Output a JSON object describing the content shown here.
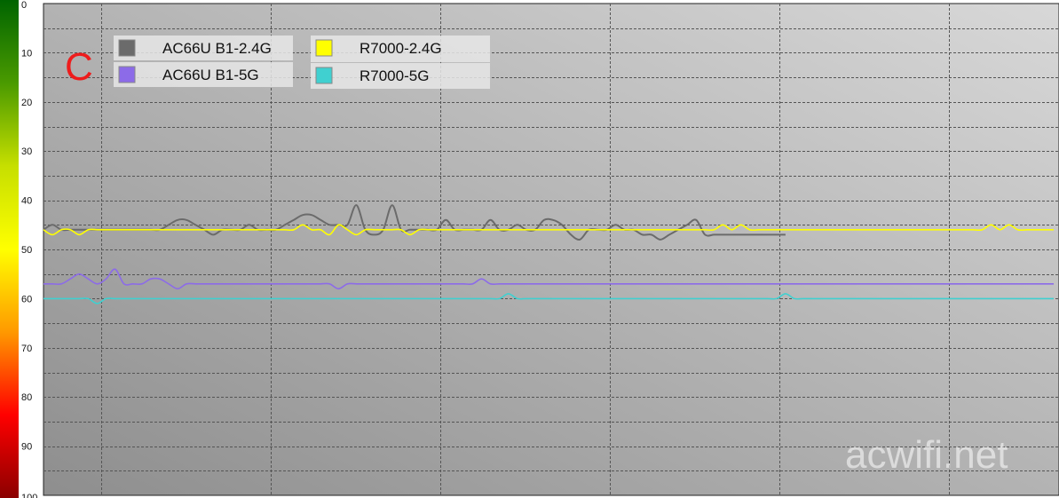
{
  "chart_data": {
    "type": "line",
    "ylim": [
      0,
      100
    ],
    "y_inverted": true,
    "y_ticks": [
      "0",
      "10",
      "20",
      "30",
      "40",
      "50",
      "60",
      "70",
      "80",
      "90",
      "100"
    ],
    "grid": true,
    "legend_position": "top-left",
    "annotation": "C",
    "watermark": "acwifi.net",
    "background_gradient": [
      "#d8d8d8",
      "#8e8e8e"
    ],
    "scale_colors": [
      "#006400",
      "#4a9a00",
      "#c6df00",
      "#ffff00",
      "#ff9900",
      "#ff0000",
      "#8b0000"
    ],
    "x": [
      0,
      10,
      20,
      30,
      40,
      50,
      60,
      70,
      80,
      90,
      100,
      110,
      120,
      130,
      140,
      150,
      160,
      170,
      180,
      190,
      200,
      210,
      220,
      230,
      240,
      250,
      260,
      270,
      280,
      290,
      300,
      310,
      320,
      330,
      340,
      350,
      360,
      370,
      380,
      390,
      400,
      410,
      420,
      430,
      440,
      450,
      460,
      470,
      480,
      490,
      500,
      510,
      520,
      530,
      540,
      550,
      560,
      570,
      580,
      590,
      600,
      610,
      620,
      630,
      640,
      650,
      660,
      670,
      680,
      690,
      700,
      710,
      720,
      730,
      740,
      750,
      760,
      770,
      780,
      790,
      800,
      810,
      820,
      830,
      840,
      850,
      860,
      870,
      880,
      890,
      900,
      910,
      920,
      930,
      940,
      950,
      960,
      970,
      980,
      990,
      1000,
      1010,
      1020,
      1030,
      1040,
      1050,
      1060,
      1070,
      1080,
      1090,
      1100,
      1110,
      1120,
      1130
    ],
    "series": [
      {
        "name": "AC66U B1-2.4G",
        "color": "#6b6b6b",
        "values": [
          46,
          45,
          46,
          46,
          46,
          46,
          46,
          46,
          46,
          46,
          46,
          46,
          46,
          46,
          45,
          44,
          44,
          45,
          46,
          47,
          46,
          46,
          46,
          45,
          46,
          46,
          46,
          45,
          44,
          43,
          43,
          44,
          45,
          45,
          45,
          41,
          46,
          47,
          46,
          41,
          46,
          46,
          46,
          46,
          46,
          44,
          46,
          46,
          46,
          46,
          44,
          46,
          46,
          45,
          46,
          46,
          44,
          44,
          45,
          47,
          48,
          46,
          46,
          46,
          45,
          46,
          46,
          47,
          47,
          48,
          47,
          46,
          45,
          44,
          47,
          47,
          47,
          47,
          47,
          47,
          47,
          47,
          47,
          47
        ]
      },
      {
        "name": "AC66U B1-5G",
        "color": "#8c6be8",
        "values": [
          57,
          57,
          57,
          56,
          55,
          56,
          57,
          56,
          54,
          57,
          57,
          57,
          56,
          56,
          57,
          58,
          57,
          57,
          57,
          57,
          57,
          57,
          57,
          57,
          57,
          57,
          57,
          57,
          57,
          57,
          57,
          57,
          57,
          58,
          57,
          57,
          57,
          57,
          57,
          57,
          57,
          57,
          57,
          57,
          57,
          57,
          57,
          57,
          57,
          56,
          57,
          57,
          57,
          57,
          57,
          57,
          57,
          57,
          57,
          57,
          57,
          57,
          57,
          57,
          57,
          57,
          57,
          57,
          57,
          57,
          57,
          57,
          57,
          57,
          57,
          57,
          57,
          57,
          57,
          57,
          57,
          57,
          57,
          57,
          57,
          57,
          57,
          57,
          57,
          57,
          57,
          57,
          57,
          57,
          57,
          57,
          57,
          57,
          57,
          57,
          57,
          57,
          57,
          57,
          57,
          57,
          57,
          57,
          57,
          57,
          57,
          57,
          57,
          57
        ]
      },
      {
        "name": "R7000-2.4G",
        "color": "#ffff00",
        "values": [
          46,
          47,
          46,
          46,
          47,
          46,
          46,
          46,
          46,
          46,
          46,
          46,
          46,
          46,
          46,
          46,
          46,
          46,
          46,
          46,
          46,
          46,
          46,
          46,
          46,
          46,
          46,
          46,
          46,
          45,
          46,
          46,
          47,
          45,
          46,
          47,
          46,
          46,
          46,
          46,
          46,
          47,
          46,
          46,
          46,
          46,
          46,
          46,
          46,
          46,
          46,
          46,
          46,
          46,
          46,
          46,
          46,
          46,
          46,
          46,
          46,
          46,
          46,
          46,
          46,
          46,
          46,
          46,
          46,
          46,
          46,
          46,
          46,
          46,
          46,
          46,
          45,
          46,
          45,
          46,
          46,
          46,
          46,
          46,
          46,
          46,
          46,
          46,
          46,
          46,
          46,
          46,
          46,
          46,
          46,
          46,
          46,
          46,
          46,
          46,
          46,
          46,
          46,
          46,
          46,
          46,
          45,
          46,
          45,
          46,
          46,
          46,
          46,
          46
        ]
      },
      {
        "name": "R7000-5G",
        "color": "#40d0d0",
        "values": [
          60,
          60,
          60,
          60,
          60,
          60,
          61,
          60,
          60,
          60,
          60,
          60,
          60,
          60,
          60,
          60,
          60,
          60,
          60,
          60,
          60,
          60,
          60,
          60,
          60,
          60,
          60,
          60,
          60,
          60,
          60,
          60,
          60,
          60,
          60,
          60,
          60,
          60,
          60,
          60,
          60,
          60,
          60,
          60,
          60,
          60,
          60,
          60,
          60,
          60,
          60,
          60,
          59,
          60,
          60,
          60,
          60,
          60,
          60,
          60,
          60,
          60,
          60,
          60,
          60,
          60,
          60,
          60,
          60,
          60,
          60,
          60,
          60,
          60,
          60,
          60,
          60,
          60,
          60,
          60,
          60,
          60,
          60,
          59,
          60,
          60,
          60,
          60,
          60,
          60,
          60,
          60,
          60,
          60,
          60,
          60,
          60,
          60,
          60,
          60,
          60,
          60,
          60,
          60,
          60,
          60,
          60,
          60,
          60,
          60,
          60,
          60,
          60,
          60
        ]
      }
    ]
  }
}
